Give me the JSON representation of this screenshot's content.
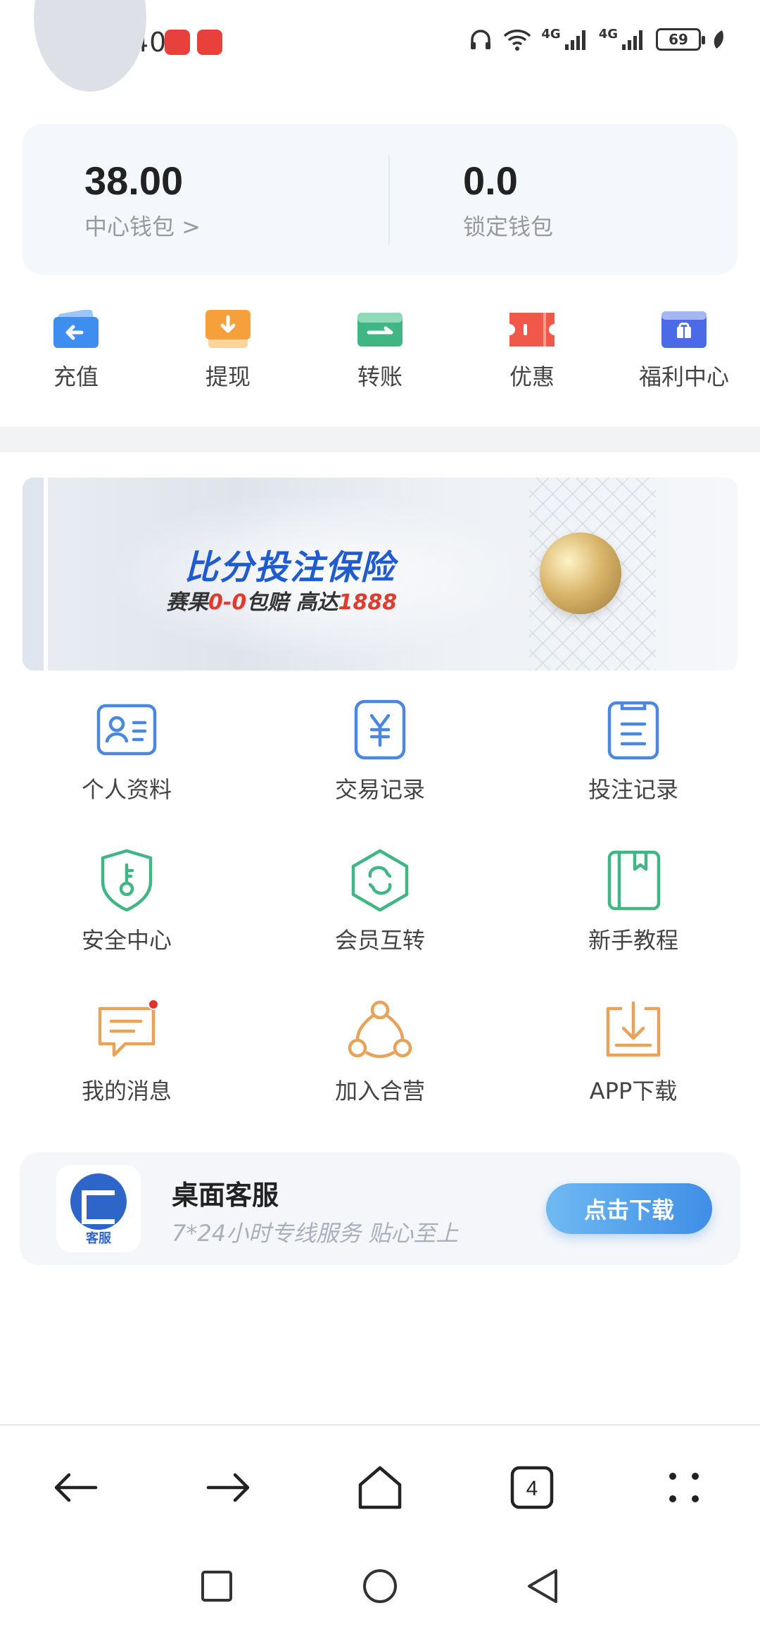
{
  "status_bar": {
    "time": "4:40",
    "network_1": "4G",
    "network_2": "4G",
    "battery": "69"
  },
  "wallet": {
    "center_amount": "38.00",
    "center_label": "中心钱包 >",
    "locked_amount": "0.0",
    "locked_label": "锁定钱包"
  },
  "quick_actions": [
    {
      "label": "充值",
      "icon": "deposit-icon",
      "color": "#3d8ef0"
    },
    {
      "label": "提现",
      "icon": "withdraw-icon",
      "color": "#f5a03a"
    },
    {
      "label": "转账",
      "icon": "transfer-icon",
      "color": "#3fb683"
    },
    {
      "label": "优惠",
      "icon": "coupon-icon",
      "color": "#f0584a"
    },
    {
      "label": "福利中心",
      "icon": "gift-icon",
      "color": "#4a6ae8"
    }
  ],
  "banner": {
    "title": "比分投注保险",
    "subtitle_prefix": "赛果",
    "subtitle_score": "0-0",
    "subtitle_mid": "包赔 高达",
    "subtitle_amount": "1888"
  },
  "menu": [
    {
      "label": "个人资料",
      "icon": "profile-card-icon",
      "color": "#4a88e0"
    },
    {
      "label": "交易记录",
      "icon": "yen-record-icon",
      "color": "#4a88e0"
    },
    {
      "label": "投注记录",
      "icon": "clipboard-icon",
      "color": "#4a88e0"
    },
    {
      "label": "安全中心",
      "icon": "shield-key-icon",
      "color": "#3fb683"
    },
    {
      "label": "会员互转",
      "icon": "hexagon-swap-icon",
      "color": "#3fb683"
    },
    {
      "label": "新手教程",
      "icon": "book-icon",
      "color": "#3fb683"
    },
    {
      "label": "我的消息",
      "icon": "message-icon",
      "color": "#e8a25a"
    },
    {
      "label": "加入合营",
      "icon": "partner-network-icon",
      "color": "#e8a25a"
    },
    {
      "label": "APP下载",
      "icon": "download-tray-icon",
      "color": "#e8a25a"
    }
  ],
  "service": {
    "logo_caption": "客服",
    "title": "桌面客服",
    "subtitle": "7*24小时专线服务 贴心至上",
    "button": "点击下载"
  },
  "browser_nav": {
    "tab_count": "4"
  }
}
